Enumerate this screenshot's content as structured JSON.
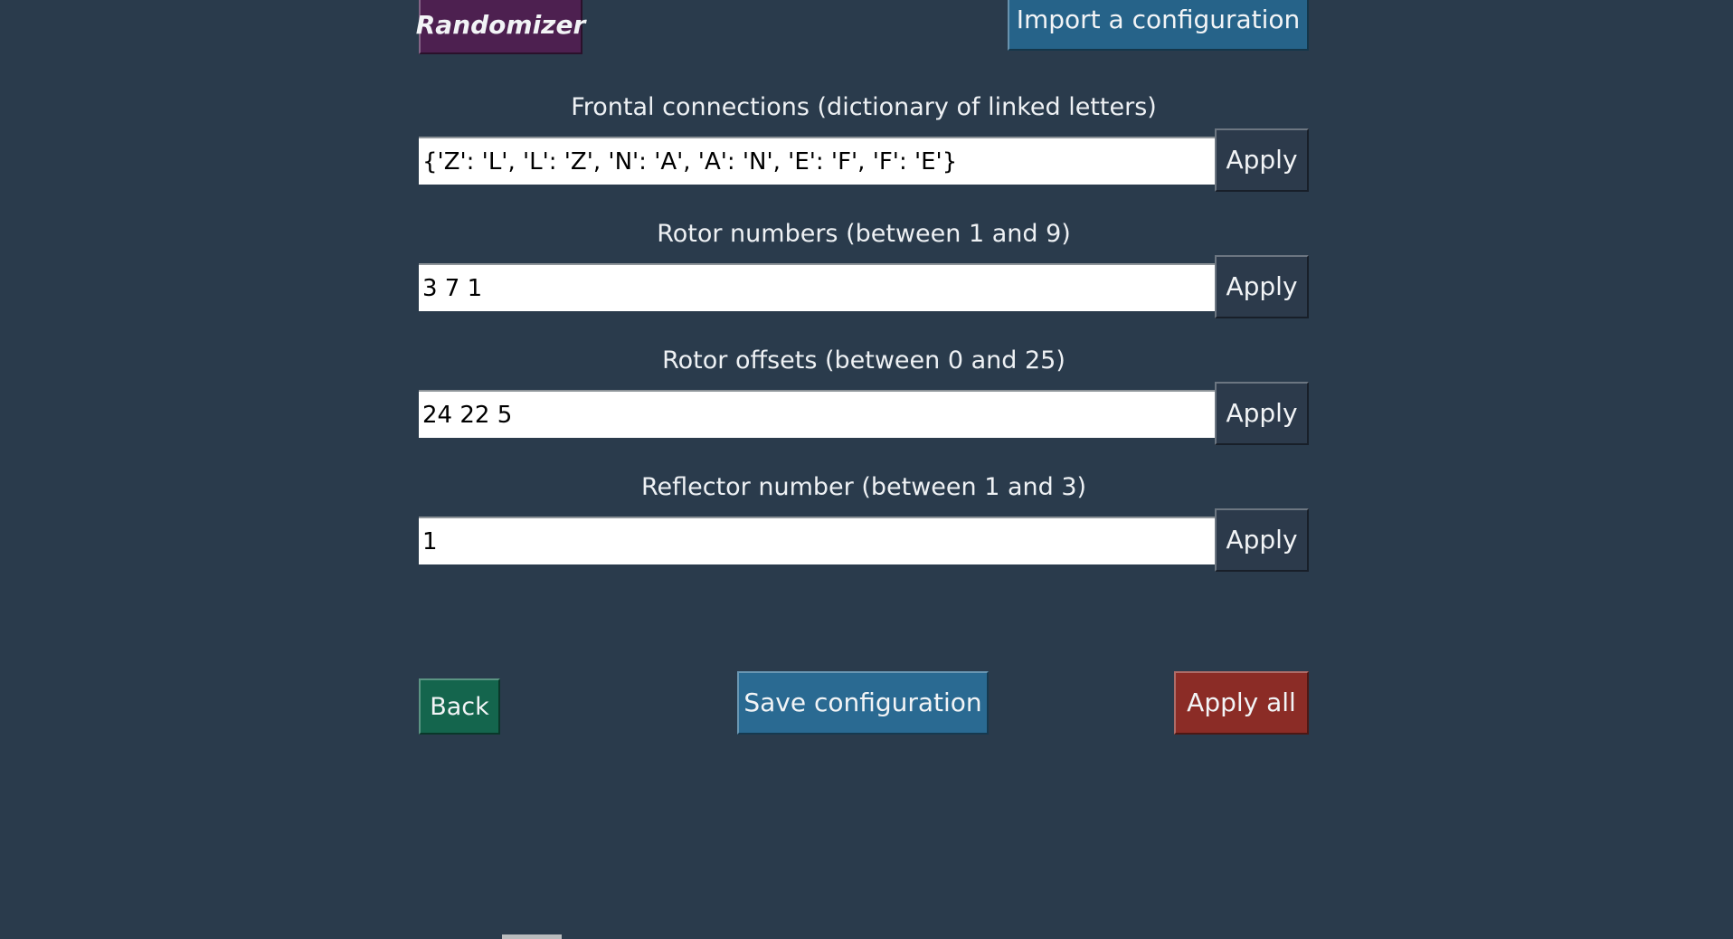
{
  "app": {
    "background_color": "#2a3b4c",
    "text_color": "#eef1f4"
  },
  "toolbar": {
    "randomizer_label": "Randomizer",
    "randomizer_color": "#4d2050",
    "import_label": "Import a configuration",
    "import_color": "#266389"
  },
  "fields": [
    {
      "label": "Frontal connections (dictionary of linked letters)",
      "value": "{'Z': 'L', 'L': 'Z', 'N': 'A', 'A': 'N', 'E': 'F', 'F': 'E'}",
      "apply_label": "Apply"
    },
    {
      "label": "Rotor numbers (between 1 and 9)",
      "value": "3 7 1",
      "apply_label": "Apply"
    },
    {
      "label": "Rotor offsets (between 0 and 25)",
      "value": "24 22 5",
      "apply_label": "Apply"
    },
    {
      "label": "Reflector number (between 1 and 3)",
      "value": "1",
      "apply_label": "Apply"
    }
  ],
  "actions": {
    "back_label": "Back",
    "back_color": "#14654d",
    "save_label": "Save configuration",
    "save_color": "#2a6a92",
    "apply_all_label": "Apply all",
    "apply_all_color": "#8b2c26"
  },
  "scrollbar": {
    "orientation": "horizontal",
    "thumb_color": "#b9bcbe"
  }
}
